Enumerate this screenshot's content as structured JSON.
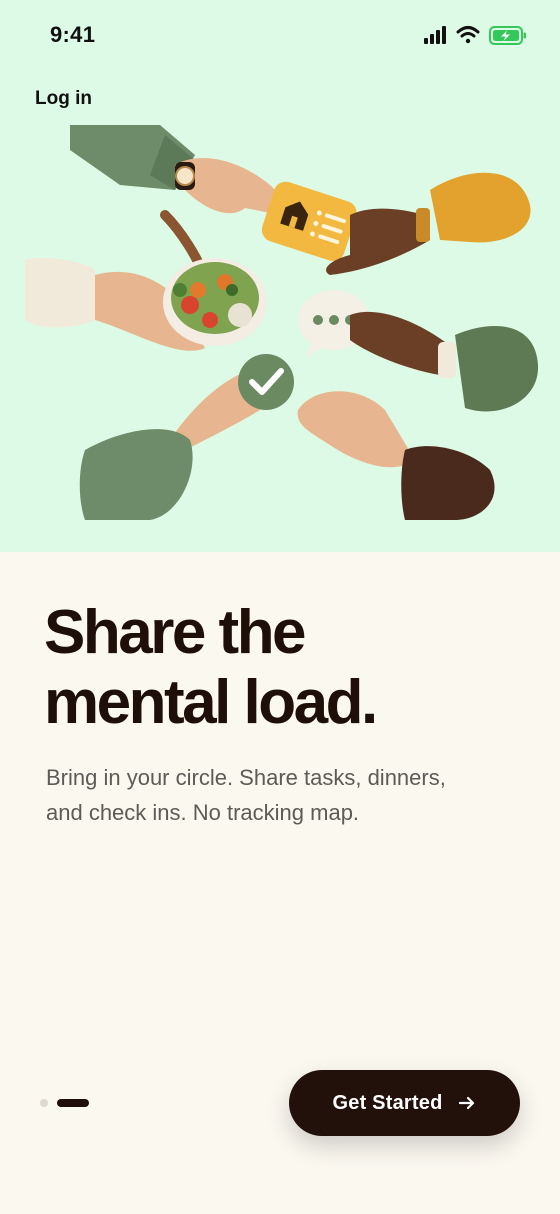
{
  "status_bar": {
    "time": "9:41",
    "icons": [
      "cellular-signal-icon",
      "wifi-icon",
      "battery-charging-icon"
    ]
  },
  "nav": {
    "login_label": "Log in"
  },
  "hero": {
    "illustration_elements": [
      "house-tasks-card-icon",
      "food-bowl-icon",
      "chat-bubble-icon",
      "checkmark-token-icon",
      "wristwatch-icon"
    ],
    "background_color": "#DCFAE5"
  },
  "content": {
    "headline_line1": "Share the",
    "headline_line2": "mental load.",
    "subtitle": "Bring in your circle. Share tasks, dinners, and check ins. No tracking map."
  },
  "pager": {
    "total": 2,
    "active_index": 1
  },
  "cta": {
    "label": "Get Started",
    "icon": "arrow-right-icon"
  },
  "colors": {
    "primary": "#22100A",
    "page_background": "#FBF8F0",
    "hero_background": "#DCFAE5",
    "body_text": "#5E5A55",
    "battery_green": "#34C759",
    "accent_yellow": "#F2B840",
    "accent_green": "#6B8A62"
  }
}
